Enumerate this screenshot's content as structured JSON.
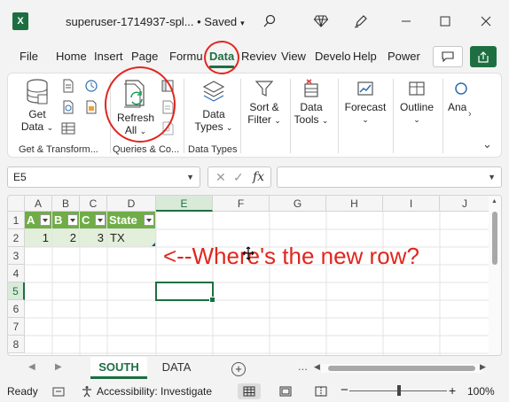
{
  "app": {
    "logo_letter": "X",
    "title": "superuser-1714937-spl... • Saved"
  },
  "tabs": [
    "File",
    "Home",
    "Insert",
    "Page",
    "Formu",
    "Data",
    "Reviev",
    "View",
    "Develo",
    "Help",
    "Power"
  ],
  "active_tab": "Data",
  "ribbon": {
    "get_data_line1": "Get",
    "get_data_line2": "Data",
    "refresh_line1": "Refresh",
    "refresh_line2": "All",
    "data_types_line1": "Data",
    "data_types_line2": "Types",
    "sort_filter_line1": "Sort &",
    "sort_filter_line2": "Filter",
    "data_tools_line1": "Data",
    "data_tools_line2": "Tools",
    "forecast": "Forecast",
    "outline": "Outline",
    "analysis": "Ana",
    "groups": [
      "Get & Transform...",
      "Queries & Co...",
      "Data Types"
    ]
  },
  "formula_bar": {
    "name_box": "E5",
    "fx": "fx",
    "cancel": "✕",
    "enter": "✓",
    "formula": ""
  },
  "grid": {
    "columns": [
      "A",
      "B",
      "C",
      "D",
      "E",
      "F",
      "G",
      "H",
      "I",
      "J"
    ],
    "rows": [
      "1",
      "2",
      "3",
      "4",
      "5",
      "6",
      "7",
      "8"
    ],
    "table_headers": [
      "A",
      "B",
      "C",
      "State"
    ],
    "table_row": [
      "1",
      "2",
      "3",
      "TX"
    ],
    "annotation": "<--Where's the new row?"
  },
  "sheets": {
    "tabs": [
      "SOUTH",
      "DATA"
    ],
    "active": "SOUTH",
    "more": "..."
  },
  "status": {
    "ready": "Ready",
    "accessibility": "Accessibility: Investigate",
    "zoom": "100%",
    "minus": "−",
    "plus": "+"
  },
  "colors": {
    "excel_green": "#1d6f42",
    "table_header": "#70ad47",
    "table_band": "#e2efda",
    "annotation_red": "#e0261e"
  }
}
